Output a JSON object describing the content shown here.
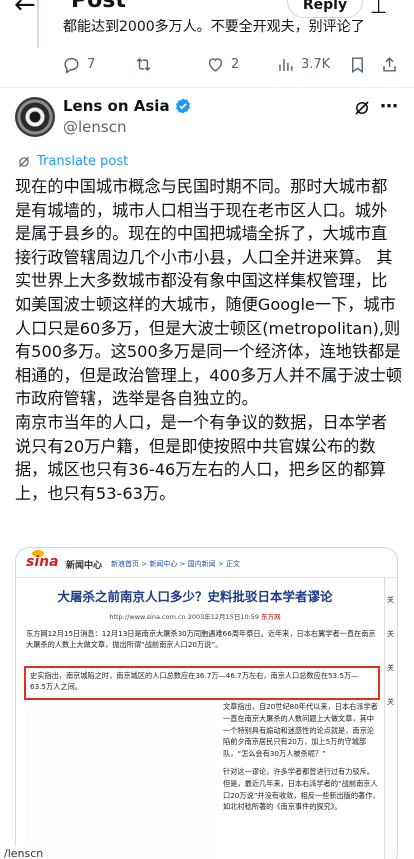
{
  "header": {
    "title": "Post",
    "reply_label": "Reply"
  },
  "previous_tweet": {
    "text": "都能达到2000多万人。不要全开观夫，别评论了"
  },
  "actions": {
    "replies": "7",
    "likes": "2",
    "views": "3.7K"
  },
  "author": {
    "name": "Lens on Asia",
    "handle": "@lenscn"
  },
  "translate_label": "Translate post",
  "body": {
    "paragraph_1": "现在的中国城市概念与民国时期不同。那时大城市都是有城墙的，城市人口相当于现在老市区人口。城外是属于县乡的。现在的中国把城墙全拆了，大城市直接行政管辖周边几个小市小县，人口全并进来算。 其实世界上大多数城市都没有象中国这样集权管理，比如美国波士顿这样的大城市，随便Google一下，城市人口只是60多万，但是大波士顿区(metropolitan),则有500多万。这500多万是同一个经济体，连地铁都是相通的，但是政治管理上，400多万人并不属于波士顿市政府管辖，选举是各自独立的。",
    "paragraph_2": "南京市当年的人口，是一个有争议的数据，日本学者说只有20万户籍，但是即使按照中共官媒公布的数据，城区也只有36-46万左右的人口，把乡区的都算上，也只有53-63万。"
  },
  "media": {
    "logo": "sina",
    "section": "新闻中心",
    "breadcrumb": "新浪首页 > 新闻中心 > 国内新闻 > 正文",
    "title": "大屠杀之前南京人口多少？史料批驳日本学者谬论",
    "url_line": "http://www.sina.com.cn 2003年12月15日10:59",
    "source": "东方网",
    "paragraph_1": "东方网12月15日消息：12月13日是南京大屠杀30万同胞遇难66周年祭日。近年来，日本右翼学者一直在南京大屠杀的人数上大做文章，抛出所谓“战前南京人口20万说”。",
    "highlight": "史实指出，南京城陷之时，南京城区的人口总数应在36.7万—46.7万左右，南京人口总数应在53.5万—63.5万人之间。",
    "col_p1": "文章指出，自20世纪80年代以来，日本右派学者一直在南京大屠杀的人数问题上大做文章，其中一个特别具有煽动和迷惑性的论点就是，南京沦陷前夕南京居民只有20万，加上5万的守城部队，“怎么会有30万人被杀呢？”",
    "col_p2": "针对这一谬论，许多学者都曾进行过有力驳斥。但是，最近几年来，日本右派学者的“战前南京人口20万说”并没有收敛，相反一些新出版的著作，如北村稔所著的《南京事件的探究》。",
    "side_labels": [
      "关",
      "关",
      "关",
      "关"
    ],
    "watermark": "/lenscn"
  },
  "colors": {
    "accent": "#1d9bf0",
    "text": "#0f1419",
    "muted": "#536471",
    "highlight_border": "#e03020"
  }
}
